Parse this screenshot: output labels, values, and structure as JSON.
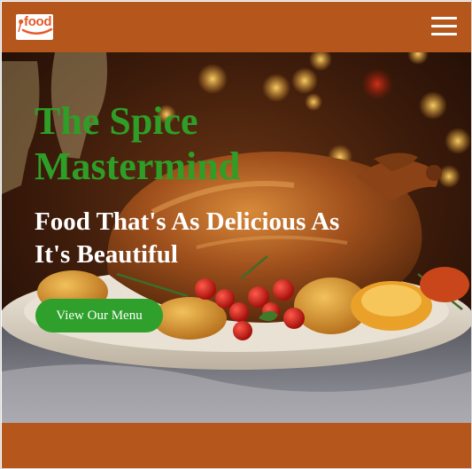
{
  "brand": {
    "logo_text": "food",
    "logo_icon": "chef-hat-icon"
  },
  "nav": {
    "menu_icon": "hamburger-menu-icon"
  },
  "hero": {
    "title": "The Spice Mastermind",
    "subtitle": "Food That's As Delicious As It's Beautiful",
    "cta_label": "View Our Menu"
  },
  "colors": {
    "brand": "#b5561d",
    "title_green": "#2f9e27",
    "button_green": "#2ea02b",
    "text_light": "#ffffff"
  }
}
